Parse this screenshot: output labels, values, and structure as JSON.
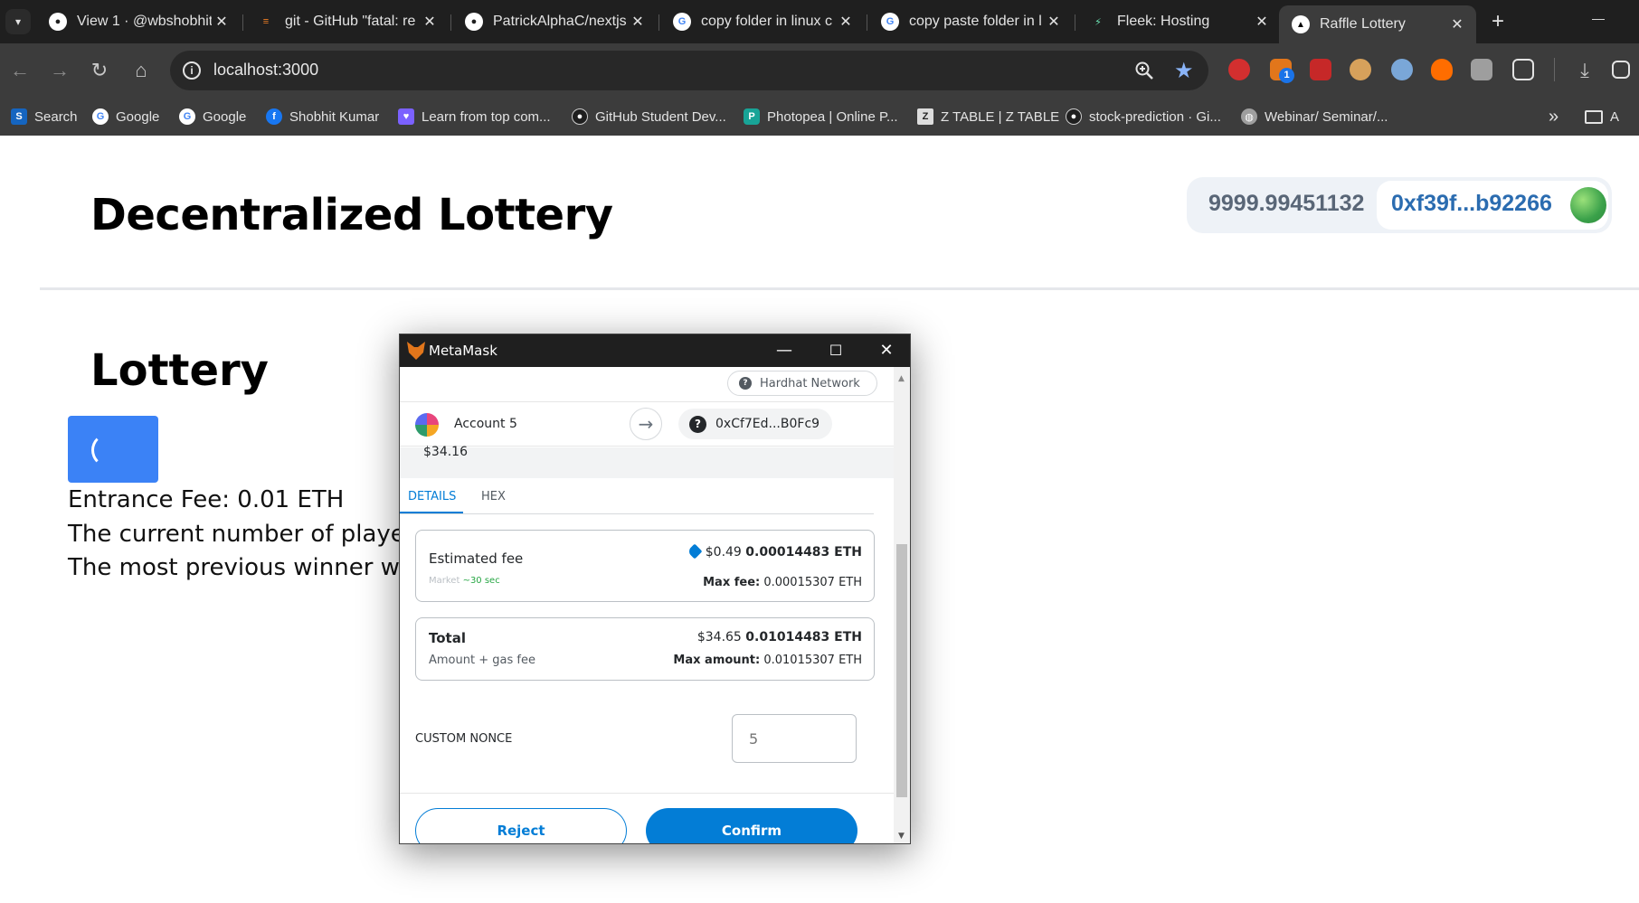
{
  "browser": {
    "tabs": [
      {
        "title": "View 1 · @wbshobhit",
        "icon": "github-icon"
      },
      {
        "title": "git - GitHub \"fatal: re",
        "icon": "stackoverflow-icon"
      },
      {
        "title": "PatrickAlphaC/nextjs",
        "icon": "github-icon"
      },
      {
        "title": "copy folder in linux c",
        "icon": "google-icon"
      },
      {
        "title": "copy paste folder in l",
        "icon": "google-icon"
      },
      {
        "title": "Fleek: Hosting",
        "icon": "fleek-icon"
      },
      {
        "title": "Raffle Lottery",
        "icon": "vercel-icon",
        "active": true
      }
    ],
    "new_tab_label": "+",
    "url": "localhost:3000",
    "bookmarks": [
      {
        "label": "Search"
      },
      {
        "label": "Google"
      },
      {
        "label": "Google"
      },
      {
        "label": "Shobhit Kumar"
      },
      {
        "label": "Learn from top com..."
      },
      {
        "label": "GitHub Student Dev..."
      },
      {
        "label": "Photopea | Online P..."
      },
      {
        "label": "Z TABLE | Z TABLE"
      },
      {
        "label": "stock-prediction · Gi..."
      },
      {
        "label": "Webinar/ Seminar/..."
      }
    ],
    "bookmarks_overflow": "»",
    "bookmarks_folder": "A",
    "extension_badge": "1"
  },
  "page": {
    "title": "Decentralized Lottery",
    "wallet": {
      "balance": "9999.99451132",
      "address": "0xf39f...b92266"
    },
    "section_title": "Lottery",
    "entrance_fee": "Entrance Fee: 0.01 ETH",
    "players": "The current number of players is:",
    "winner": "The most previous winner was: 0x"
  },
  "metamask": {
    "window_title": "MetaMask",
    "network": "Hardhat Network",
    "account": "Account 5",
    "to_address": "0xCf7Ed...B0Fc9",
    "amount_usd": "$34.16",
    "tabs": [
      "DETAILS",
      "HEX"
    ],
    "estimated_fee": {
      "label": "Estimated fee",
      "usd": "$0.49",
      "eth": "0.00014483 ETH",
      "speed_label": "Market",
      "speed_time": "~30 sec",
      "max_fee_label": "Max fee:",
      "max_fee_value": "0.00015307 ETH"
    },
    "total": {
      "label": "Total",
      "sub": "Amount + gas fee",
      "usd": "$34.65",
      "eth": "0.01014483 ETH",
      "max_amount_label": "Max amount:",
      "max_amount_value": "0.01015307 ETH"
    },
    "custom_nonce_label": "CUSTOM NONCE",
    "custom_nonce_placeholder": "5",
    "reject_label": "Reject",
    "confirm_label": "Confirm"
  },
  "colors": {
    "accent": "#037dd6",
    "enter_button": "#3b82f6",
    "address_text": "#2b6cb0"
  }
}
